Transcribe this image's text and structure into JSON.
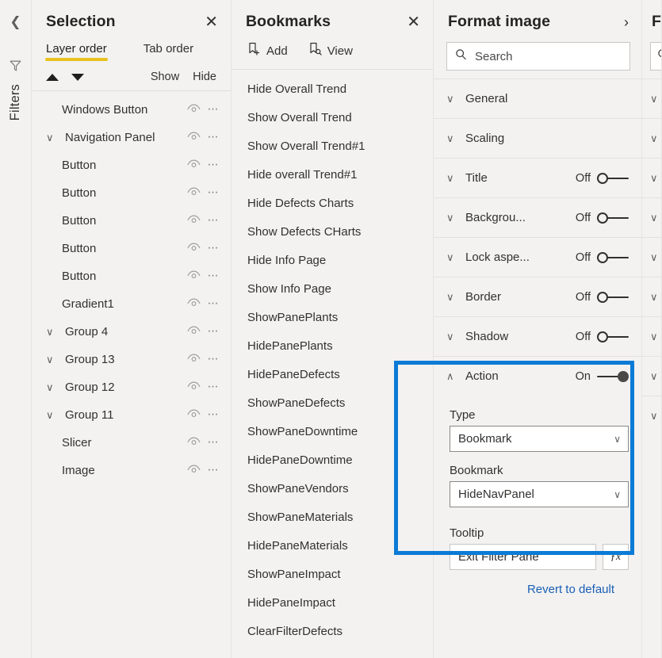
{
  "rail": {
    "collapse_icon": "chevron-left-icon",
    "filter_icon": "funnel-icon",
    "label": "Filters"
  },
  "selection": {
    "title": "Selection",
    "close_label": "✕",
    "tabs": [
      {
        "label": "Layer order",
        "active": true
      },
      {
        "label": "Tab order",
        "active": false
      }
    ],
    "move_up_icon": "triangle-up-icon",
    "move_down_icon": "triangle-down-icon",
    "show_label": "Show",
    "hide_label": "Hide",
    "layers": [
      {
        "name": "Windows Button",
        "expandable": false,
        "indent": false
      },
      {
        "name": "Navigation Panel",
        "expandable": true,
        "indent": true
      },
      {
        "name": "Button",
        "expandable": false,
        "indent": false
      },
      {
        "name": "Button",
        "expandable": false,
        "indent": false
      },
      {
        "name": "Button",
        "expandable": false,
        "indent": false
      },
      {
        "name": "Button",
        "expandable": false,
        "indent": false
      },
      {
        "name": "Button",
        "expandable": false,
        "indent": false
      },
      {
        "name": "Gradient1",
        "expandable": false,
        "indent": false
      },
      {
        "name": "Group 4",
        "expandable": true,
        "indent": true
      },
      {
        "name": "Group 13",
        "expandable": true,
        "indent": true
      },
      {
        "name": "Group 12",
        "expandable": true,
        "indent": true
      },
      {
        "name": "Group 11",
        "expandable": true,
        "indent": true
      },
      {
        "name": "Slicer",
        "expandable": false,
        "indent": false
      },
      {
        "name": "Image",
        "expandable": false,
        "indent": false
      }
    ]
  },
  "bookmarks": {
    "title": "Bookmarks",
    "close_label": "✕",
    "toolbar": [
      {
        "label": "Add",
        "icon": "add-bookmark-icon"
      },
      {
        "label": "View",
        "icon": "view-bookmark-icon"
      }
    ],
    "items": [
      "Hide Overall Trend",
      "Show Overall Trend",
      "Show Overall Trend#1",
      "Hide overall Trend#1",
      "Hide Defects Charts",
      "Show Defects CHarts",
      "Hide Info Page",
      "Show Info Page",
      "ShowPanePlants",
      "HidePanePlants",
      "HidePaneDefects",
      "ShowPaneDefects",
      "ShowPaneDowntime",
      "HidePaneDowntime",
      "ShowPaneVendors",
      "ShowPaneMaterials",
      "HidePaneMaterials",
      "ShowPaneImpact",
      "HidePaneImpact",
      "ClearFilterDefects"
    ]
  },
  "format": {
    "title": "Format image",
    "expand_label": "›",
    "search_placeholder": "Search",
    "search_value": "",
    "sections": [
      {
        "label": "General",
        "expanded": false,
        "toggle": null
      },
      {
        "label": "Scaling",
        "expanded": false,
        "toggle": null
      },
      {
        "label": "Title",
        "expanded": false,
        "toggle": "Off"
      },
      {
        "label": "Backgrou...",
        "expanded": false,
        "toggle": "Off"
      },
      {
        "label": "Lock aspe...",
        "expanded": false,
        "toggle": "Off"
      },
      {
        "label": "Border",
        "expanded": false,
        "toggle": "Off"
      },
      {
        "label": "Shadow",
        "expanded": false,
        "toggle": "Off"
      }
    ],
    "action": {
      "label": "Action",
      "expanded": true,
      "toggle": "On",
      "type_label": "Type",
      "type_value": "Bookmark",
      "bookmark_label": "Bookmark",
      "bookmark_value": "HideNavPanel"
    },
    "tooltip": {
      "label": "Tooltip",
      "value": "Exit Filter Pane",
      "fx_label": "ƒx"
    },
    "revert_label": "Revert to default",
    "highlight_color": "#0c7bd6",
    "accent_color": "#e8c21f",
    "link_color": "#1a5fb4"
  },
  "right_pane": {
    "title": "Fi",
    "search_placeholder": "",
    "rows": [
      "",
      "",
      "",
      "",
      "",
      "",
      "",
      "",
      ""
    ]
  }
}
